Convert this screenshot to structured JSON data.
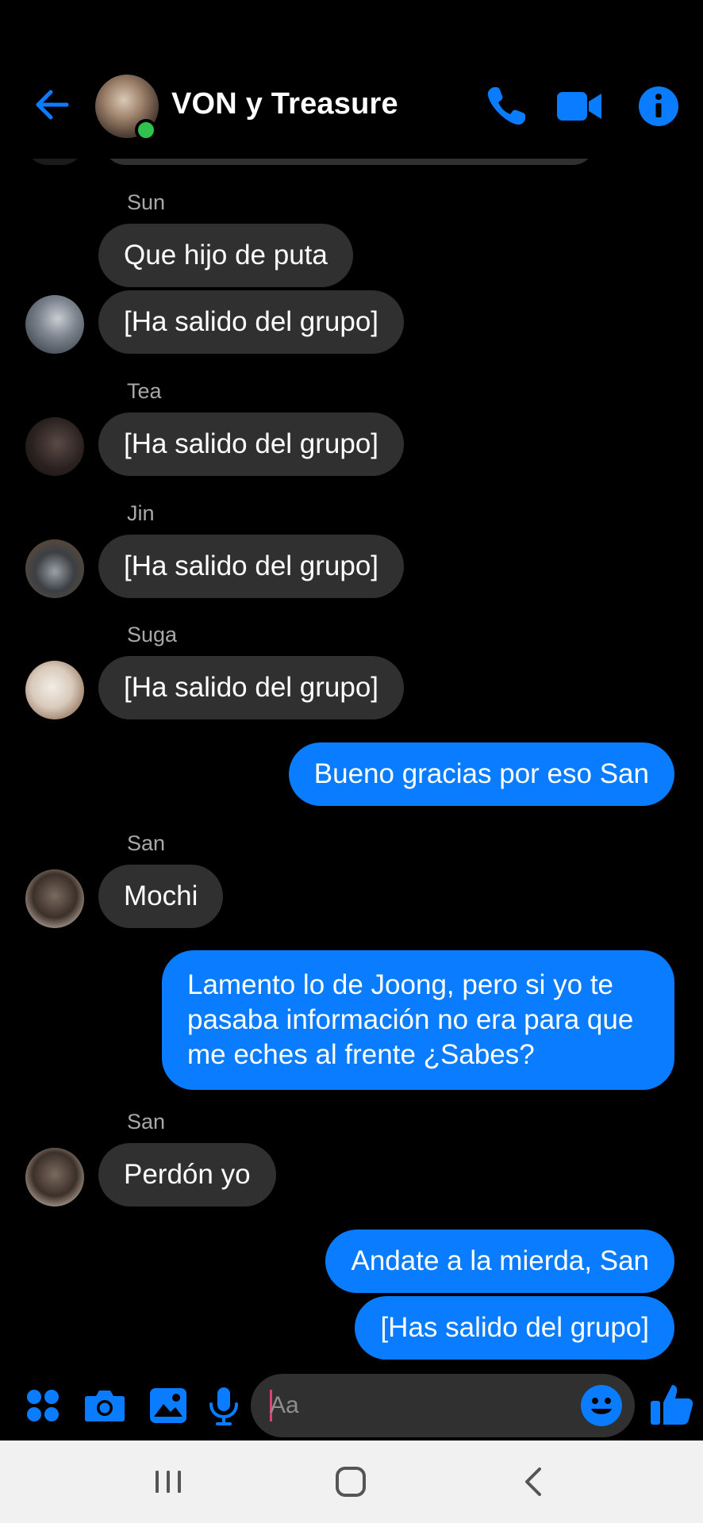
{
  "header": {
    "title": "VON y Treasure",
    "accent": "#0a7cff",
    "online_color": "#31c24d"
  },
  "messages": [
    {
      "sender": "Sun",
      "text": "Que hijo de puta"
    },
    {
      "text": "[Ha salido del grupo]"
    },
    {
      "sender": "Tea",
      "text": "[Ha salido del grupo]"
    },
    {
      "sender": "Jin",
      "text": "[Ha salido del grupo]"
    },
    {
      "sender": "Suga",
      "text": "[Ha salido del grupo]"
    },
    {
      "me": true,
      "text": "Bueno gracias por eso San"
    },
    {
      "sender": "San",
      "text": "Mochi"
    },
    {
      "me": true,
      "text": "Lamento lo de Joong, pero si yo te pasaba información no era para que me eches al frente ¿Sabes?"
    },
    {
      "sender": "San",
      "text": "Perdón yo"
    },
    {
      "me": true,
      "text": "Andate a la mierda, San"
    },
    {
      "me": true,
      "text": "[Has salido del grupo]"
    }
  ],
  "composer": {
    "placeholder": "Aa",
    "icons": [
      "menu-dots-icon",
      "camera-icon",
      "gallery-icon",
      "microphone-icon",
      "emoji-icon",
      "thumbs-up-icon"
    ]
  },
  "navbar": {
    "icons": [
      "recent-apps-icon",
      "home-icon",
      "back-icon"
    ]
  }
}
